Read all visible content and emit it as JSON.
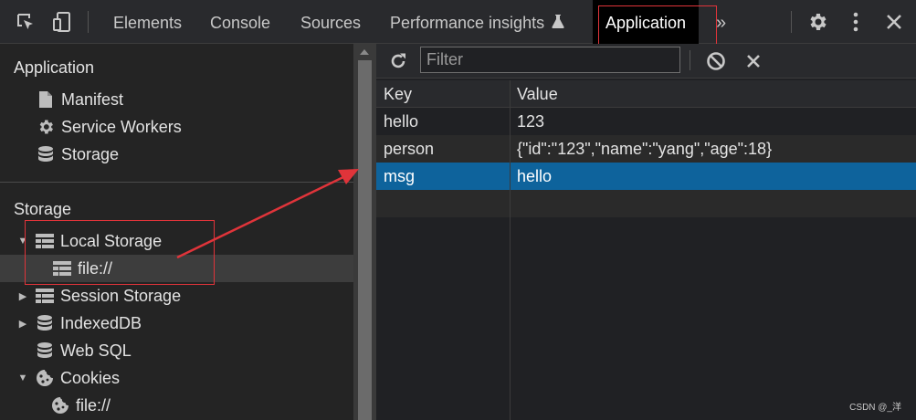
{
  "toolbar": {
    "tabs": [
      "Elements",
      "Console",
      "Sources",
      "Performance insights",
      "Application"
    ],
    "more": "»",
    "flask_icon": "flask-icon"
  },
  "sidebar": {
    "application_title": "Application",
    "application_items": [
      "Manifest",
      "Service Workers",
      "Storage"
    ],
    "storage_title": "Storage",
    "storage_items": [
      "Local Storage",
      "file://",
      "Session Storage",
      "IndexedDB",
      "Web SQL",
      "Cookies",
      "file://"
    ]
  },
  "main": {
    "filter_placeholder": "Filter",
    "columns": {
      "key": "Key",
      "value": "Value"
    },
    "rows": [
      {
        "key": "hello",
        "value": "123"
      },
      {
        "key": "person",
        "value": "{\"id\":\"123\",\"name\":\"yang\",\"age\":18}"
      },
      {
        "key": "msg",
        "value": "hello"
      }
    ],
    "selected_row": 2
  },
  "watermark": "CSDN @_洋",
  "colors": {
    "selection": "#0e639c",
    "annotation": "#e0343a",
    "background": "#242424"
  }
}
